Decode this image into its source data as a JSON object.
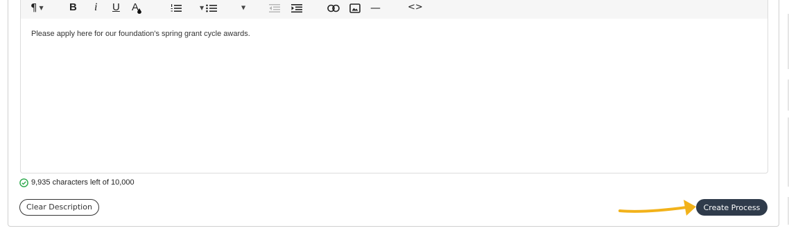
{
  "toolbar": {
    "icons": {
      "paragraph": "¶",
      "bold": "B",
      "italic": "i",
      "underline": "U",
      "text_color": "A",
      "horizontal_rule": "—",
      "code_view": "<>"
    },
    "accent_color": "#2f3b4b"
  },
  "editor": {
    "content": "Please apply here for our foundation's spring grant cycle awards."
  },
  "status": {
    "text": "9,935 characters left of 10,000",
    "color": "#2aa84a"
  },
  "buttons": {
    "clear_label": "Clear Description",
    "create_label": "Create Process"
  },
  "annotation": {
    "arrow_color": "#f2b21a"
  }
}
